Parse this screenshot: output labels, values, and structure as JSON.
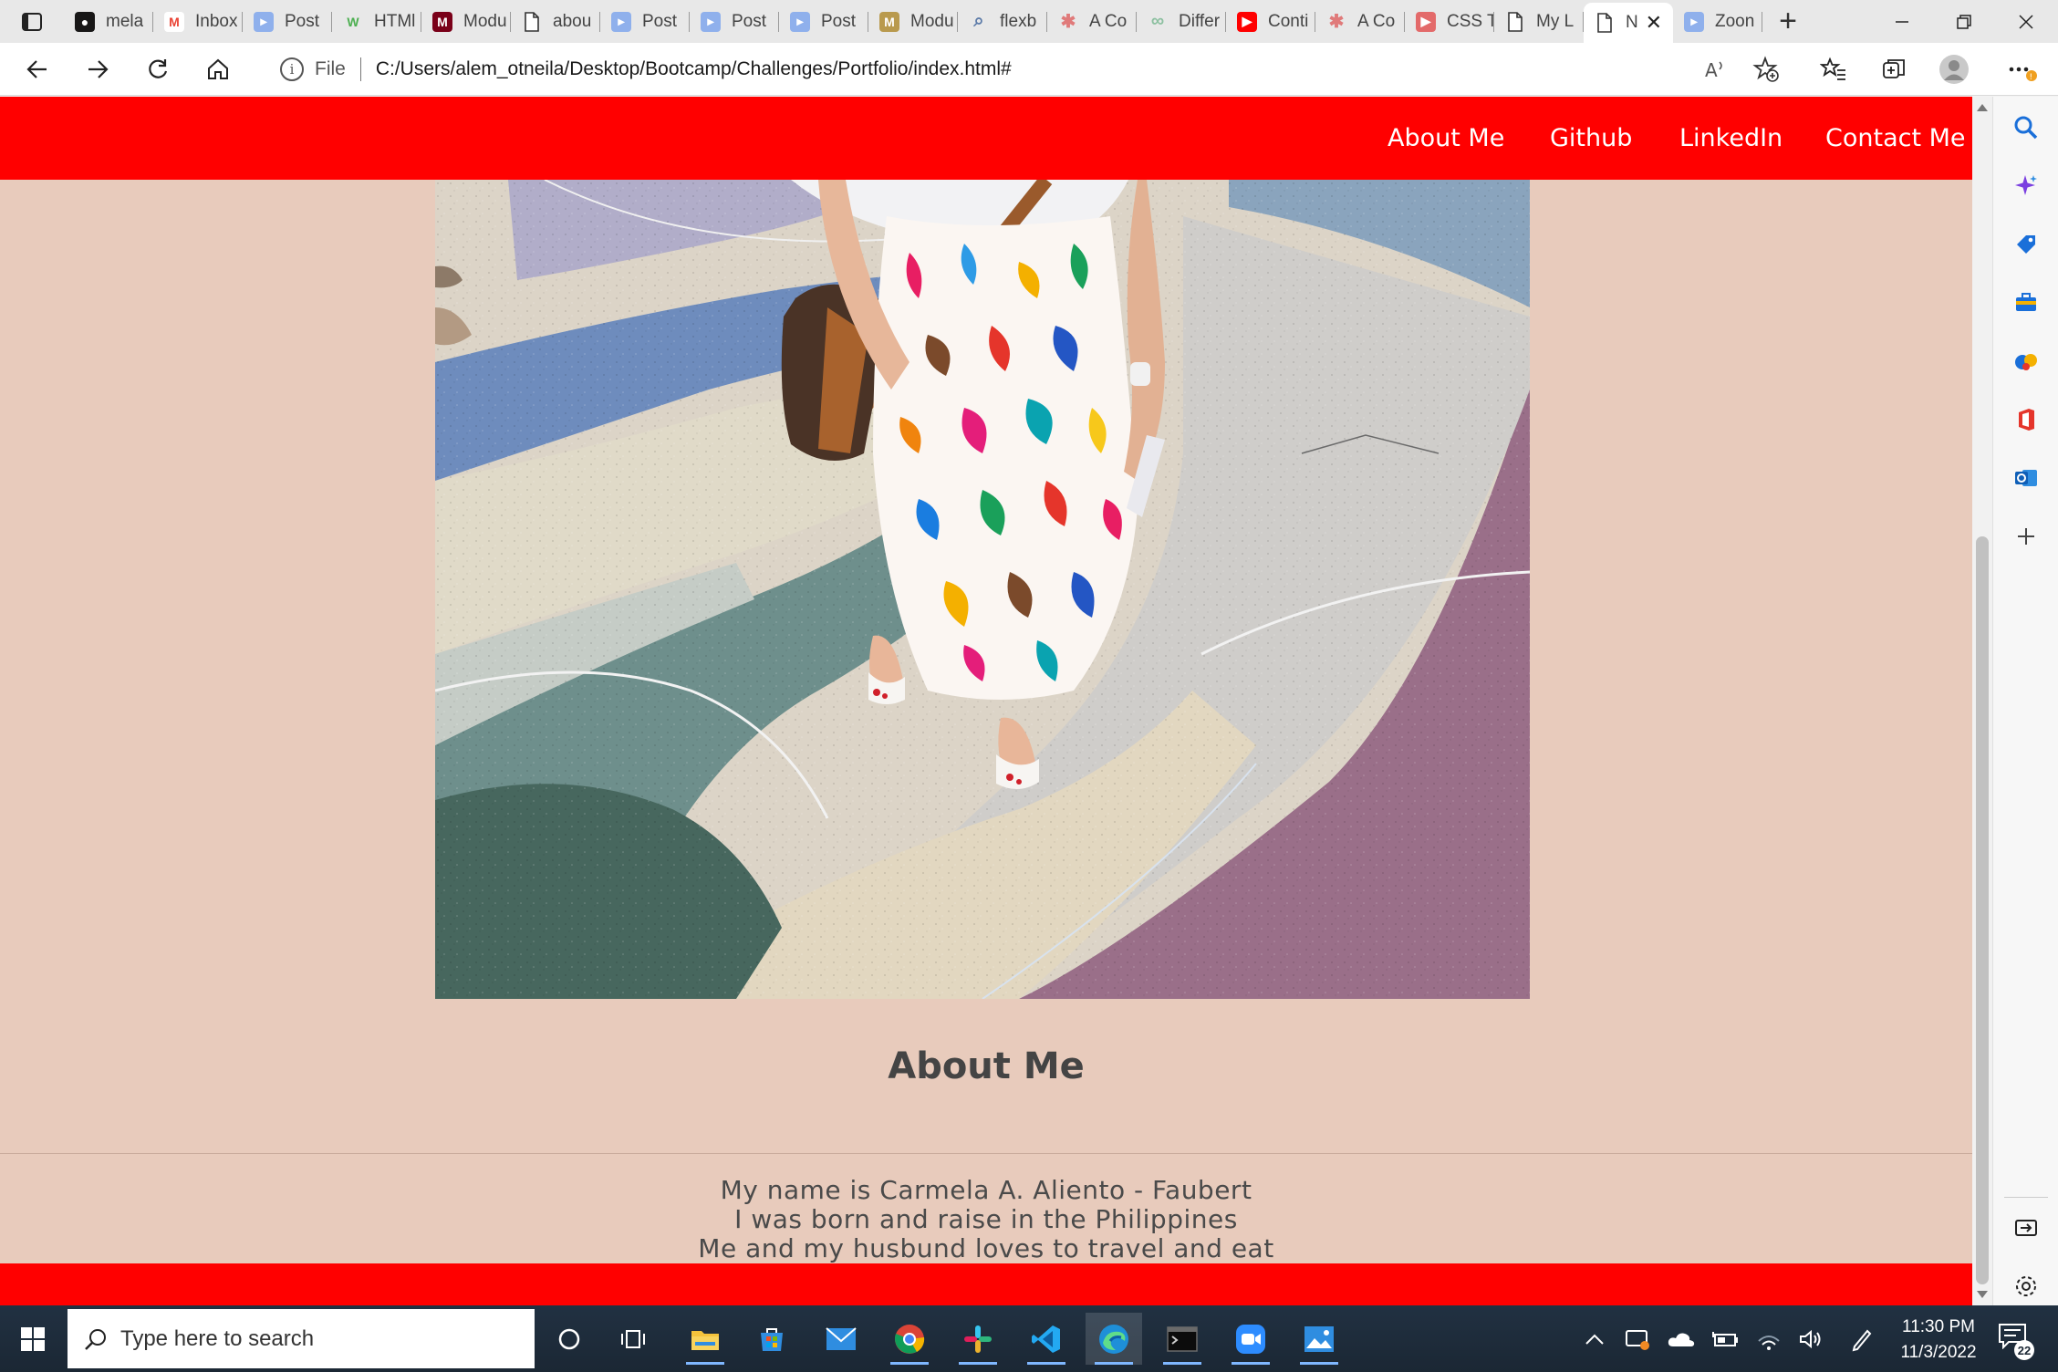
{
  "browser": {
    "tabs": [
      {
        "icon": "github-icon",
        "title": "mela",
        "favicon_color": "#181717"
      },
      {
        "icon": "gmail-icon",
        "title": "Inbox",
        "favicon_color": "#ea4335"
      },
      {
        "icon": "zoom-icon",
        "title": "Post",
        "favicon_color": "#8fb0ec"
      },
      {
        "icon": "w3schools-icon",
        "title": "HTMl",
        "favicon_color": "#4caf50"
      },
      {
        "icon": "university-icon",
        "title": "Modu",
        "favicon_color": "#7a0019"
      },
      {
        "icon": "page-icon",
        "title": "abou",
        "favicon_color": "#ffffff"
      },
      {
        "icon": "zoom-icon",
        "title": "Post",
        "favicon_color": "#8fb0ec"
      },
      {
        "icon": "zoom-icon",
        "title": "Post",
        "favicon_color": "#8fb0ec"
      },
      {
        "icon": "zoom-icon",
        "title": "Post",
        "favicon_color": "#8fb0ec"
      },
      {
        "icon": "university-icon",
        "title": "Modu",
        "favicon_color": "#b99a4e"
      },
      {
        "icon": "search-icon",
        "title": "flexb",
        "favicon_color": "#5b7aa8"
      },
      {
        "icon": "asterisk-icon",
        "title": "A Co",
        "favicon_color": "#e07a7a"
      },
      {
        "icon": "link-icon",
        "title": "Differ",
        "favicon_color": "#8cc0a0"
      },
      {
        "icon": "youtube-icon",
        "title": "Conti",
        "favicon_color": "#ff0000"
      },
      {
        "icon": "asterisk-icon",
        "title": "A Co",
        "favicon_color": "#e07a7a"
      },
      {
        "icon": "youtube-icon",
        "title": "CSS T",
        "favicon_color": "#e36a6a"
      },
      {
        "icon": "page-icon",
        "title": "My L",
        "favicon_color": "#ffffff"
      },
      {
        "icon": "page-icon",
        "title": "N",
        "favicon_color": "#ffffff",
        "active": true
      },
      {
        "icon": "zoom-icon",
        "title": "Zoon",
        "favicon_color": "#8fb0ec"
      }
    ],
    "address": {
      "scheme_label": "File",
      "url": "C:/Users/alem_otneila/Desktop/Bootcamp/Challenges/Portfolio/index.html#"
    }
  },
  "site": {
    "nav": [
      "About Me",
      "Github",
      "LinkedIn",
      "Contact Me"
    ],
    "about_title": "About Me",
    "about_lines": [
      "My name is Carmela A. Aliento - Faubert",
      "I was born and raise in the Philippines",
      "Me and my husbund loves to travel and eat"
    ],
    "brand_color": "#ff0000",
    "background_color": "#e8cbbc"
  },
  "taskbar": {
    "search_placeholder": "Type here to search",
    "time": "11:30 PM",
    "date": "11/3/2022",
    "notification_count": "22",
    "apps": [
      "cortana-icon",
      "task-view-icon",
      "file-explorer-icon",
      "microsoft-store-icon",
      "mail-icon",
      "chrome-icon",
      "slack-icon",
      "vscode-icon",
      "edge-icon",
      "terminal-icon",
      "zoom-icon",
      "photos-icon"
    ]
  }
}
